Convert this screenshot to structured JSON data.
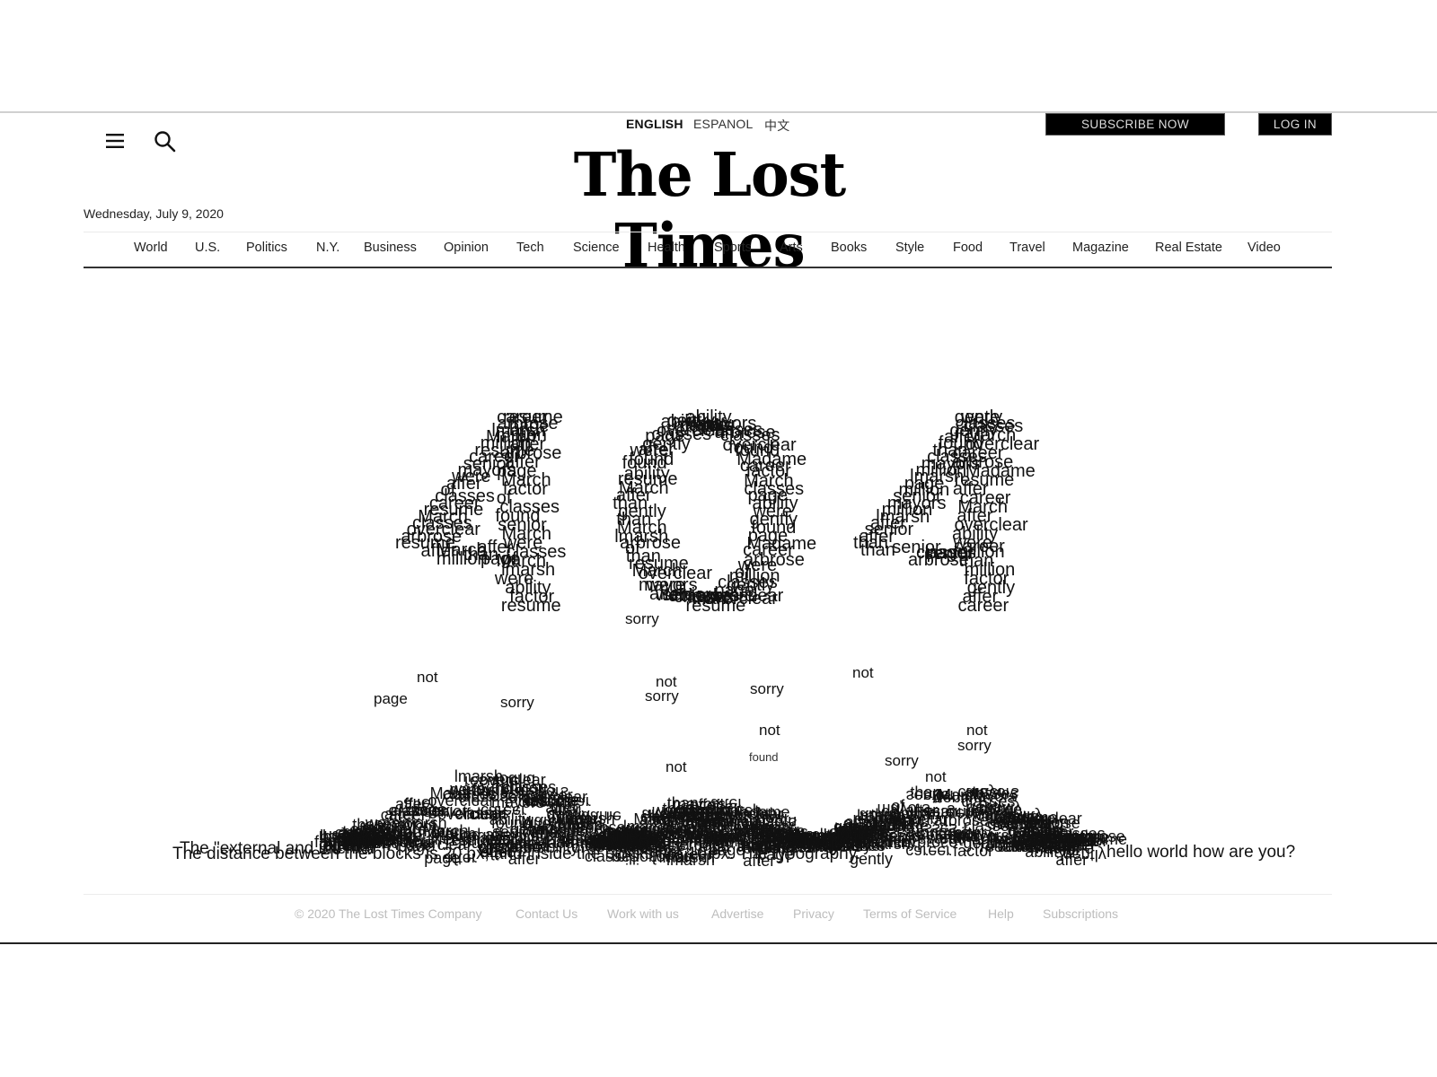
{
  "header": {
    "menu_icon": "hamburger-menu-icon",
    "search_icon": "magnifier-search-icon",
    "languages": [
      {
        "label": "ENGLISH",
        "active": true
      },
      {
        "label": "ESPANOL",
        "active": false
      },
      {
        "label": "中文",
        "active": false
      }
    ],
    "subscribe_label": "SUBSCRIBE NOW",
    "login_label": "LOG IN",
    "masthead": "The Lost Times",
    "date": "Wednesday, July 9, 2020"
  },
  "nav": {
    "items": [
      "World",
      "U.S.",
      "Politics",
      "N.Y.",
      "Business",
      "Opinion",
      "Tech",
      "Science",
      "Health",
      "Sports",
      "Arts",
      "Books",
      "Style",
      "Food",
      "Travel",
      "Magazine",
      "Real Estate",
      "Video"
    ]
  },
  "error_art": {
    "headline": "404",
    "scattered_words": [
      "sorry",
      "not",
      "page",
      "sorry",
      "not",
      "sorry",
      "sorry",
      "not",
      "not",
      "found",
      "not",
      "sorry",
      "sorry",
      "not",
      "not"
    ],
    "glyph_words": [
      "than",
      "career",
      "lmarsh",
      "overclear",
      "after",
      "March",
      "affer",
      "factor",
      "classes",
      "were",
      "million",
      "resume",
      "arbrose",
      "mayors",
      "ability",
      "classes",
      "gently",
      "of",
      "after",
      "Madame",
      "senior",
      "found",
      "page"
    ],
    "baseline_text": "The distance between the blocks is 20 px, and inside the blocks are 10 px. The typography.",
    "overlay_text": "The \"external and internal",
    "tail_text": "hello world how are you?"
  },
  "footer": {
    "copyright": "© 2020 The Lost Times Company",
    "links": [
      "Contact Us",
      "Work with us",
      "Advertise",
      "Privacy",
      "Terms of Service",
      "Help",
      "Subscriptions"
    ]
  },
  "colors": {
    "text": "#121212",
    "button_bg": "#000000",
    "footer_text": "#bdbdbd"
  }
}
